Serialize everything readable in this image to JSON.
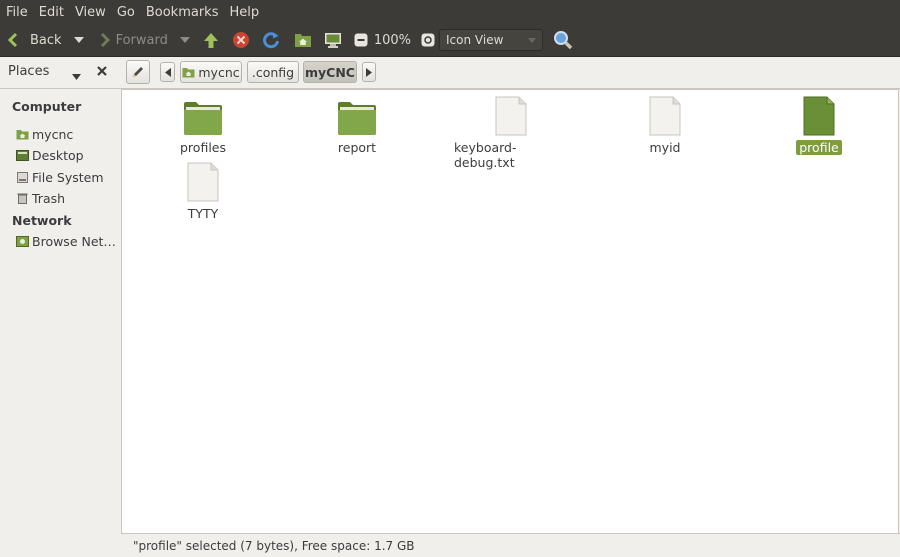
{
  "menu": [
    "File",
    "Edit",
    "View",
    "Go",
    "Bookmarks",
    "Help"
  ],
  "toolbar": {
    "back_label": "Back",
    "forward_label": "Forward",
    "zoom": "100%",
    "view_mode": "Icon View"
  },
  "location": {
    "places_label": "Places",
    "crumbs": [
      "mycnc",
      ".config",
      "myCNC"
    ]
  },
  "sidebar": {
    "computer_heading": "Computer",
    "computer_items": [
      {
        "label": "mycnc",
        "icon": "home-folder-icon"
      },
      {
        "label": "Desktop",
        "icon": "desktop-icon"
      },
      {
        "label": "File System",
        "icon": "harddisk-icon"
      },
      {
        "label": "Trash",
        "icon": "trash-icon"
      }
    ],
    "network_heading": "Network",
    "network_items": [
      {
        "label": "Browse Net…",
        "icon": "network-icon"
      }
    ]
  },
  "files": [
    {
      "name": "profiles",
      "kind": "folder",
      "selected": false
    },
    {
      "name": "report",
      "kind": "folder",
      "selected": false
    },
    {
      "name": "keyboard-debug.txt",
      "kind": "document",
      "selected": false
    },
    {
      "name": "myid",
      "kind": "document",
      "selected": false
    },
    {
      "name": "profile",
      "kind": "document",
      "selected": true
    },
    {
      "name": "TYTY",
      "kind": "document",
      "selected": false
    }
  ],
  "status": "\"profile\" selected (7 bytes), Free space: 1.7 GB",
  "colors": {
    "menubar_bg": "#3c3b37",
    "accent_green": "#7f9c3e",
    "folder_green": "#7fa046"
  }
}
